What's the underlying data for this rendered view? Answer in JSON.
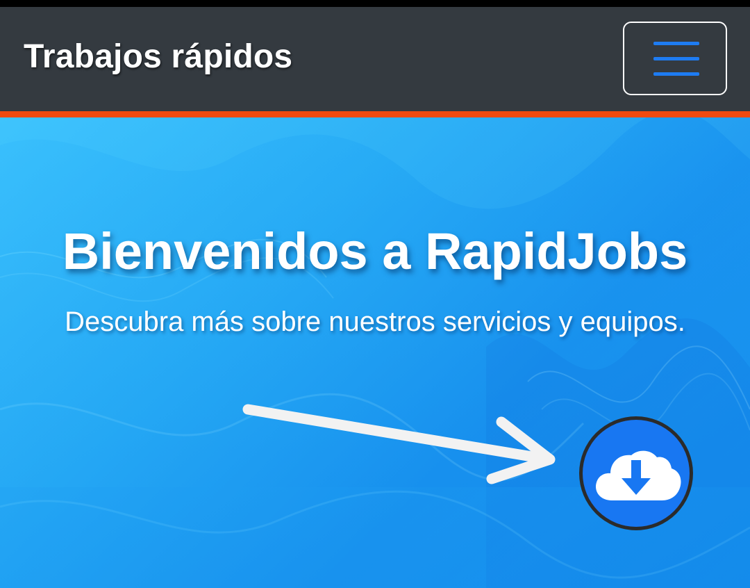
{
  "navbar": {
    "brand": "Trabajos rápidos",
    "menu_icon": "hamburger-menu-icon"
  },
  "hero": {
    "title": "Bienvenidos a RapidJobs",
    "subtitle": "Descubra más sobre nuestros servicios y equipos."
  },
  "overlay": {
    "arrow_icon": "arrow-right-icon",
    "download_icon": "cloud-download-icon"
  },
  "colors": {
    "navbar_bg": "#343a40",
    "navbar_accent": "#f04a0f",
    "hero_blue": "#1ea7f5",
    "menu_icon_blue": "#1e7cf2",
    "download_blue": "#1877f2"
  }
}
